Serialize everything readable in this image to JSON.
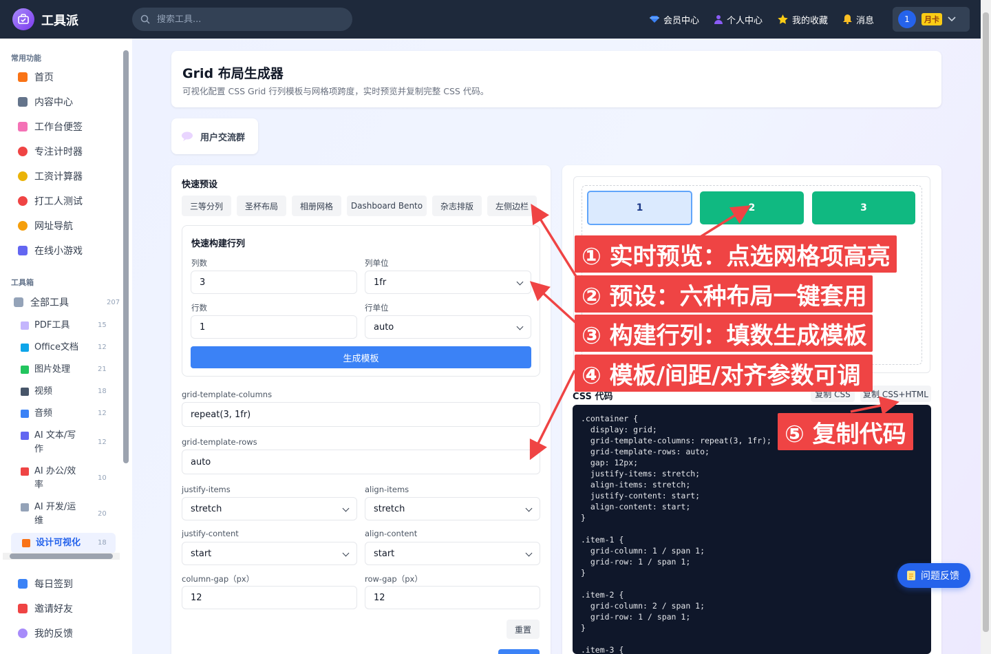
{
  "app": {
    "name": "工具派"
  },
  "search": {
    "placeholder": "搜索工具..."
  },
  "nav": {
    "member": "会员中心",
    "profile": "个人中心",
    "favorites": "我的收藏",
    "messages": "消息"
  },
  "user": {
    "avatar": "1",
    "plan": "月卡"
  },
  "sidebar": {
    "section_common": "常用功能",
    "common": [
      {
        "label": "首页",
        "icon": "home-icon",
        "color": "#f97316"
      },
      {
        "label": "内容中心",
        "icon": "newspaper-icon",
        "color": "#64748b"
      },
      {
        "label": "工作台便签",
        "icon": "memo-icon",
        "color": "#f472b6"
      },
      {
        "label": "专注计时器",
        "icon": "stopwatch-icon",
        "color": "#ef4444"
      },
      {
        "label": "工资计算器",
        "icon": "money-bag-icon",
        "color": "#eab308"
      },
      {
        "label": "打工人测试",
        "icon": "target-icon",
        "color": "#ef4444"
      },
      {
        "label": "网址导航",
        "icon": "compass-icon",
        "color": "#f59e0b"
      },
      {
        "label": "在线小游戏",
        "icon": "gamepad-icon",
        "color": "#6366f1"
      }
    ],
    "section_tools": "工具箱",
    "all_tools": {
      "label": "全部工具",
      "count": "207",
      "icon": "tools-icon"
    },
    "categories": [
      {
        "label": "PDF工具",
        "count": "15",
        "icon": "document-icon",
        "color": "#c4b5fd"
      },
      {
        "label": "Office文档",
        "count": "12",
        "icon": "book-icon",
        "color": "#0ea5e9"
      },
      {
        "label": "图片处理",
        "count": "21",
        "icon": "picture-icon",
        "color": "#22c55e"
      },
      {
        "label": "视频",
        "count": "18",
        "icon": "clapper-icon",
        "color": "#475569"
      },
      {
        "label": "音频",
        "count": "12",
        "icon": "music-note-icon",
        "color": "#3b82f6"
      },
      {
        "label": "AI 文本/写作",
        "count": "12",
        "icon": "robot-icon",
        "color": "#6366f1"
      },
      {
        "label": "AI 办公/效率",
        "count": "10",
        "icon": "rocket-icon",
        "color": "#ef4444"
      },
      {
        "label": "AI 开发/运维",
        "count": "20",
        "icon": "wrench-icon",
        "color": "#94a3b8"
      },
      {
        "label": "设计可视化",
        "count": "18",
        "icon": "palette-icon",
        "color": "#f97316"
      }
    ],
    "bottom": [
      {
        "label": "每日签到",
        "icon": "calendar-icon",
        "color": "#3b82f6"
      },
      {
        "label": "邀请好友",
        "icon": "gift-icon",
        "color": "#ef4444"
      },
      {
        "label": "我的反馈",
        "icon": "speech-bubble-icon",
        "color": "#a78bfa"
      }
    ]
  },
  "header": {
    "title": "Grid 布局生成器",
    "desc": "可视化配置 CSS Grid 行列模板与网格项跨度，实时预览并复制完整 CSS 代码。"
  },
  "community": {
    "label": "用户交流群"
  },
  "presets": {
    "title": "快速预设",
    "items": [
      "三等分列",
      "圣杯布局",
      "相册网格",
      "Dashboard Bento",
      "杂志排版",
      "左侧边栏"
    ]
  },
  "builder": {
    "title": "快速构建行列",
    "cols_label": "列数",
    "cols_value": "3",
    "col_unit_label": "列单位",
    "col_unit_value": "1fr",
    "rows_label": "行数",
    "rows_value": "1",
    "row_unit_label": "行单位",
    "row_unit_value": "auto",
    "generate": "生成模板"
  },
  "settings": {
    "gtc_label": "grid-template-columns",
    "gtc_value": "repeat(3, 1fr)",
    "gtr_label": "grid-template-rows",
    "gtr_value": "auto",
    "ji_label": "justify-items",
    "ji_value": "stretch",
    "ai_label": "align-items",
    "ai_value": "stretch",
    "jc_label": "justify-content",
    "jc_value": "start",
    "ac_label": "align-content",
    "ac_value": "start",
    "cg_label": "column-gap（px）",
    "cg_value": "12",
    "rg_label": "row-gap（px）",
    "rg_value": "12",
    "reset": "重置"
  },
  "preview": {
    "items": [
      "1",
      "2",
      "3"
    ],
    "selected_index": 0
  },
  "code": {
    "title": "CSS 代码",
    "copy_css": "复制 CSS",
    "copy_all": "复制 CSS+HTML",
    "text": ".container {\n  display: grid;\n  grid-template-columns: repeat(3, 1fr);\n  grid-template-rows: auto;\n  gap: 12px;\n  justify-items: stretch;\n  align-items: stretch;\n  justify-content: start;\n  align-content: start;\n}\n\n.item-1 {\n  grid-column: 1 / span 1;\n  grid-row: 1 / span 1;\n}\n\n.item-2 {\n  grid-column: 2 / span 1;\n  grid-row: 1 / span 1;\n}\n\n.item-3 {"
  },
  "annotations": [
    "① 实时预览：点选网格项高亮",
    "② 预设：六种布局一键套用",
    "③ 构建行列：填数生成模板",
    "④ 模板/间距/对齐参数可调",
    "⑤ 复制代码"
  ],
  "feedback": {
    "label": "问题反馈"
  },
  "colors": {
    "accent": "#3b82f6",
    "cell_green": "#10b981",
    "annotation_red": "#ef4444",
    "topbar": "#1e293b"
  }
}
